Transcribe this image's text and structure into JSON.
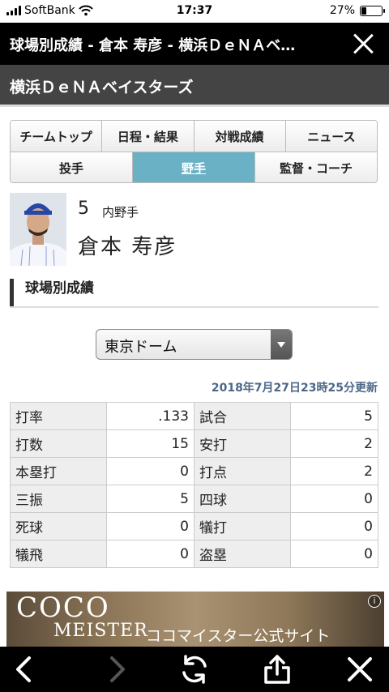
{
  "status": {
    "carrier": "SoftBank",
    "time": "17:37",
    "battery": "27%",
    "battery_level": 0.27
  },
  "title_bar": {
    "title": "球場別成績 - 倉本 寿彦 - 横浜ＤｅＮＡベ…"
  },
  "team": {
    "name": "横浜ＤｅＮＡベイスターズ"
  },
  "tabs": {
    "row1": [
      "チームトップ",
      "日程・結果",
      "対戦成績",
      "ニュース"
    ],
    "row2": [
      "投手",
      "野手",
      "監督・コーチ"
    ]
  },
  "player": {
    "number": "5",
    "position": "内野手",
    "name": "倉本 寿彦"
  },
  "section": {
    "title": "球場別成績"
  },
  "stadium_select": {
    "value": "東京ドーム"
  },
  "updated": "2018年7月27日23時25分更新",
  "stats": [
    {
      "k1": "打率",
      "v1": ".133",
      "k2": "試合",
      "v2": "5"
    },
    {
      "k1": "打数",
      "v1": "15",
      "k2": "安打",
      "v2": "2"
    },
    {
      "k1": "本塁打",
      "v1": "0",
      "k2": "打点",
      "v2": "2"
    },
    {
      "k1": "三振",
      "v1": "5",
      "k2": "四球",
      "v2": "0"
    },
    {
      "k1": "死球",
      "v1": "0",
      "k2": "犠打",
      "v2": "0"
    },
    {
      "k1": "犠飛",
      "v1": "0",
      "k2": "盗塁",
      "v2": "0"
    }
  ],
  "ad": {
    "logo_line1": "COCO",
    "logo_line2": "MEISTER",
    "tagline": "ココマイスター公式サイト",
    "info": "i"
  },
  "toolbar": {
    "icons": [
      "back-icon",
      "forward-icon",
      "reload-icon",
      "share-icon",
      "close-icon"
    ]
  }
}
